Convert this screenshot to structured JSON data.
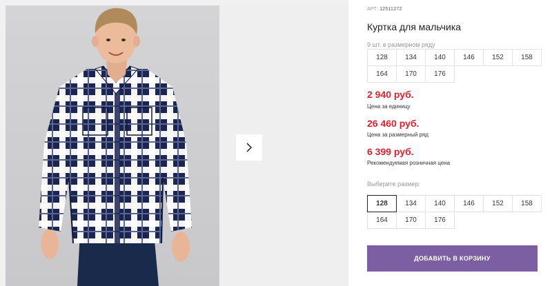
{
  "gallery": {
    "next_icon": "chevron-right-icon"
  },
  "product": {
    "sku_label": "АРТ:",
    "sku_value": "12511272",
    "title": "Куртка для мальчика",
    "series_note": "9 шт. в размерном ряду",
    "series_sizes": [
      "128",
      "134",
      "140",
      "146",
      "152",
      "158",
      "164",
      "170",
      "176"
    ],
    "prices": [
      {
        "value": "2 940 руб.",
        "label": "Цена за единицу"
      },
      {
        "value": "26 460 руб.",
        "label": "Цена за размерный ряд"
      },
      {
        "value": "6 399 руб.",
        "label": "Рекомендуемая розничная цена"
      }
    ],
    "choose_label": "Выберите размер:",
    "size_options": [
      "128",
      "134",
      "140",
      "146",
      "152",
      "158",
      "164",
      "170",
      "176"
    ],
    "selected_size": "128",
    "add_to_cart": "ДОБАВИТЬ В КОРЗИНУ"
  },
  "colors": {
    "price": "#e4202f",
    "button": "#7c5fa2"
  }
}
